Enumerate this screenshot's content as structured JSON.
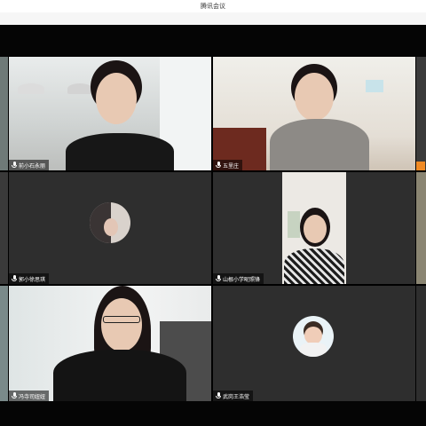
{
  "window": {
    "title": "腾讯会议"
  },
  "participants": [
    {
      "name": "前小石永丽"
    },
    {
      "name": "五里庄"
    },
    {
      "name": "郭小徐思琪"
    },
    {
      "name": "山根小学昵照锋"
    },
    {
      "name": "冯寺司妞妞"
    },
    {
      "name": "武岗王浩莹"
    }
  ],
  "colors": {
    "tile_bg": "#2e2e2e",
    "host_badge": "#f08a24",
    "caption_text": "#ffffff"
  }
}
